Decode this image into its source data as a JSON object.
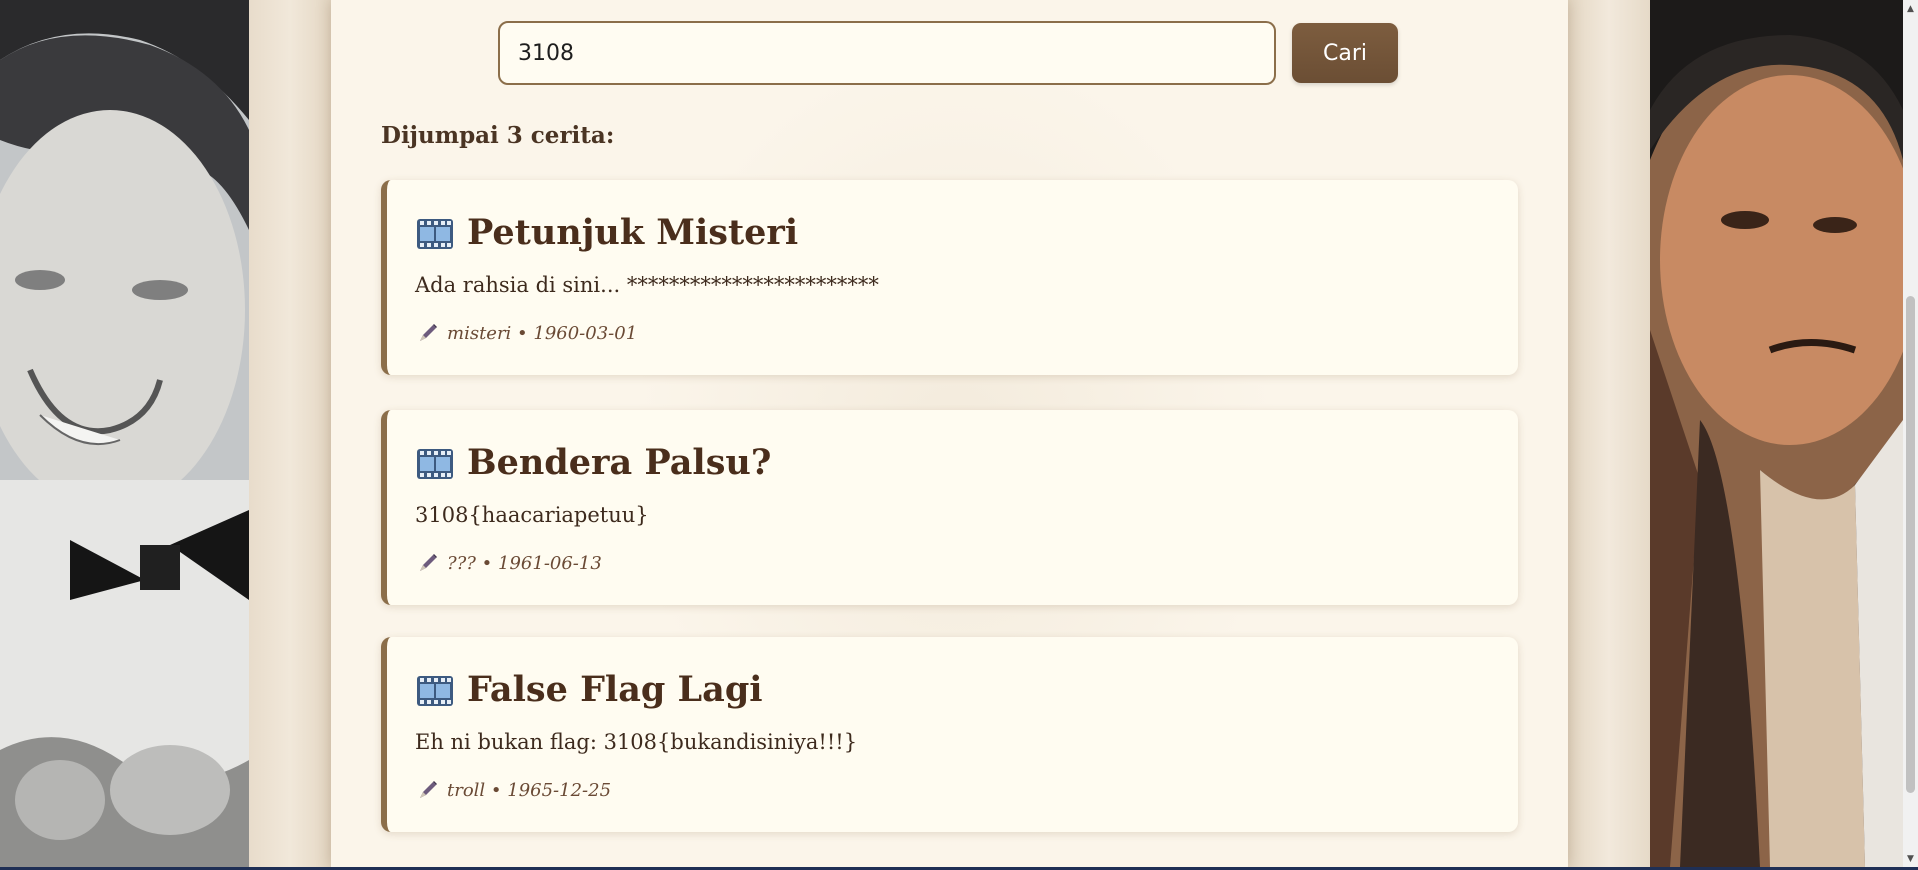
{
  "search": {
    "value": "3108",
    "button_label": "Cari"
  },
  "results": {
    "count_label": "Dijumpai 3 cerita:",
    "items": [
      {
        "title": "Petunjuk Misteri",
        "body": "Ada rahsia di sini... ************************",
        "meta": "misteri • 1960-03-01"
      },
      {
        "title": "Bendera Palsu?",
        "body": "3108{haacariapetuu}",
        "meta": "??? • 1961-06-13"
      },
      {
        "title": "False Flag Lagi",
        "body": "Eh ni bukan flag: 3108{bukandisiniya!!!}",
        "meta": "troll • 1965-12-25"
      }
    ]
  },
  "icons": {
    "card_title_icon": "film-frames-icon",
    "card_meta_icon": "pen-icon"
  },
  "colors": {
    "accent": "#8b6e4a",
    "button": "#7d5d3f",
    "card_bg": "#fffcf1",
    "title": "#4a2e1c"
  }
}
